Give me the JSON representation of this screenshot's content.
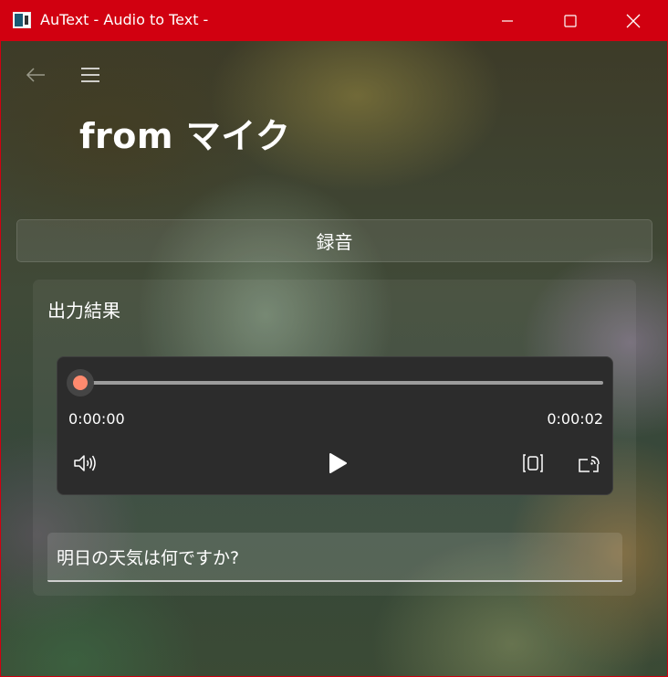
{
  "window": {
    "title": "AuText - Audio to Text -",
    "accent_color": "#d10010"
  },
  "nav": {
    "back_icon": "arrow-left-icon",
    "menu_icon": "hamburger-menu-icon"
  },
  "page": {
    "title": "from マイク"
  },
  "record_button": {
    "label": "録音"
  },
  "result": {
    "label": "出力結果",
    "player": {
      "current_time": "0:00:00",
      "total_time": "0:00:02",
      "progress": 0,
      "thumb_color": "#ff8a6e",
      "buttons": [
        "volume-icon",
        "play-icon",
        "aspect-ratio-icon",
        "cast-icon"
      ]
    },
    "transcript": "明日の天気は何ですか?"
  }
}
